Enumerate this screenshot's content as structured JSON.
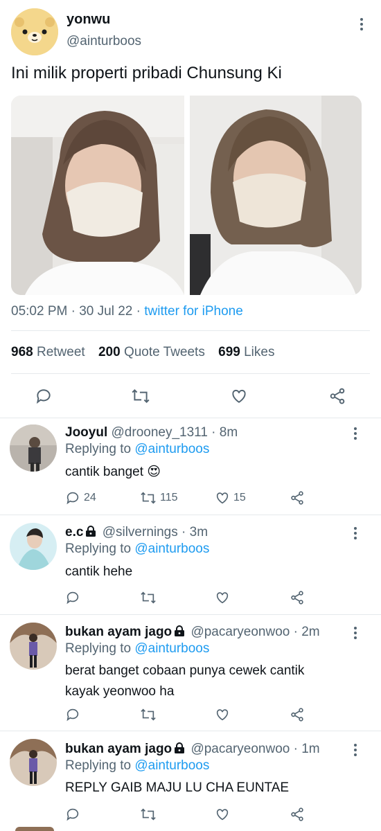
{
  "tweet": {
    "display_name": "yonwu",
    "handle": "@ainturboos",
    "text": "Ini milik properti pribadi Chunsung Ki",
    "time": "05:02 PM",
    "date": "30 Jul 22",
    "source": "twitter for iPhone",
    "retweets": "968",
    "retweets_label": "Retweet",
    "quotes": "200",
    "quotes_label": "Quote Tweets",
    "likes": "699",
    "likes_label": "Likes"
  },
  "replies": [
    {
      "name": "Jooyul",
      "handle": "@drooney_1311",
      "time": "8m",
      "replying_label": "Replying to",
      "replying_to": "@ainturboos",
      "text": "cantik banget 😍",
      "reply_count": "24",
      "retweet_count": "115",
      "like_count": "15"
    },
    {
      "name": "e.c",
      "handle": "@silvernings",
      "time": "3m",
      "replying_label": "Replying to",
      "replying_to": "@ainturboos",
      "text": "cantik hehe"
    },
    {
      "name": "bukan ayam jago",
      "handle": "@pacaryeonwoo",
      "time": "2m",
      "replying_label": "Replying to",
      "replying_to": "@ainturboos",
      "text": "berat banget cobaan punya cewek cantik kayak yeonwoo ha"
    },
    {
      "name": "bukan ayam jago",
      "handle": "@pacaryeonwoo",
      "time": "1m",
      "replying_label": "Replying to",
      "replying_to": "@ainturboos",
      "text": "REPLY GAIB MAJU LU CHA EUNTAE"
    }
  ],
  "colors": {
    "accent": "#1d9bf0",
    "secondary_text": "#536471",
    "divider": "#e5e9ec"
  },
  "icons": [
    "reply-icon",
    "retweet-icon",
    "like-icon",
    "share-icon",
    "more-icon",
    "lock-icon"
  ]
}
